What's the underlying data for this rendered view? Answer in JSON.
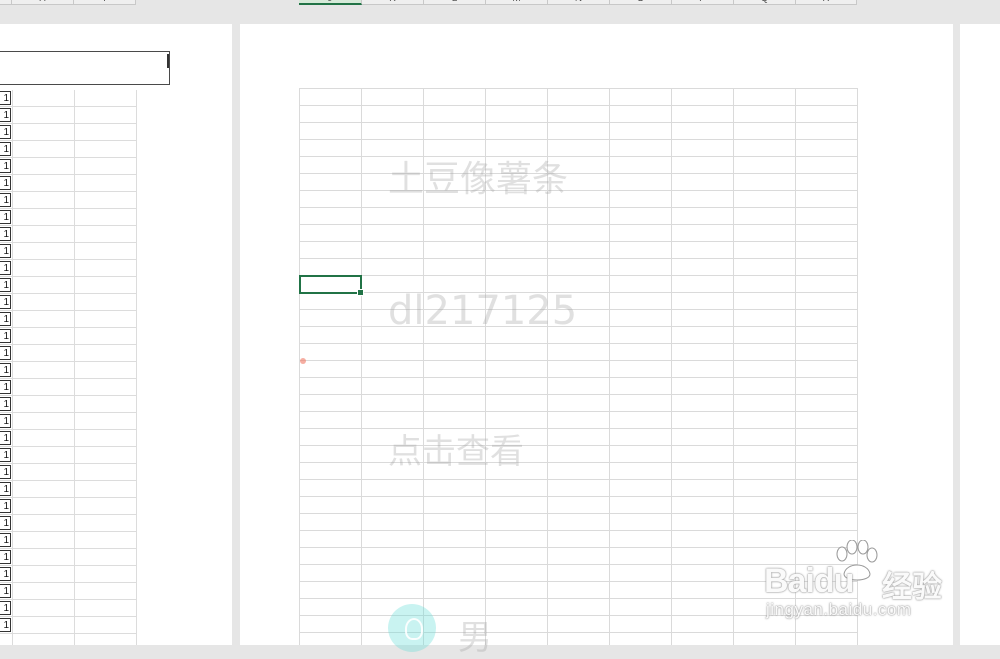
{
  "column_headers": {
    "left": [
      "H",
      "I"
    ],
    "right": [
      "J",
      "K",
      "L",
      "M",
      "N",
      "O",
      "P",
      "Q",
      "R"
    ],
    "active": "J"
  },
  "left_sheet": {
    "row_value": "1",
    "row_count": 32
  },
  "watermark": {
    "title": "土豆像薯条",
    "id": "dl217125",
    "link": "点击查看",
    "gender": "男"
  },
  "baidu_logo": {
    "brand": "Baidu",
    "brand_cn": "经验",
    "url": "jingyan.baidu.com"
  },
  "colors": {
    "selection": "#217346",
    "gridline": "#dadada",
    "background": "#e6e6e6"
  }
}
